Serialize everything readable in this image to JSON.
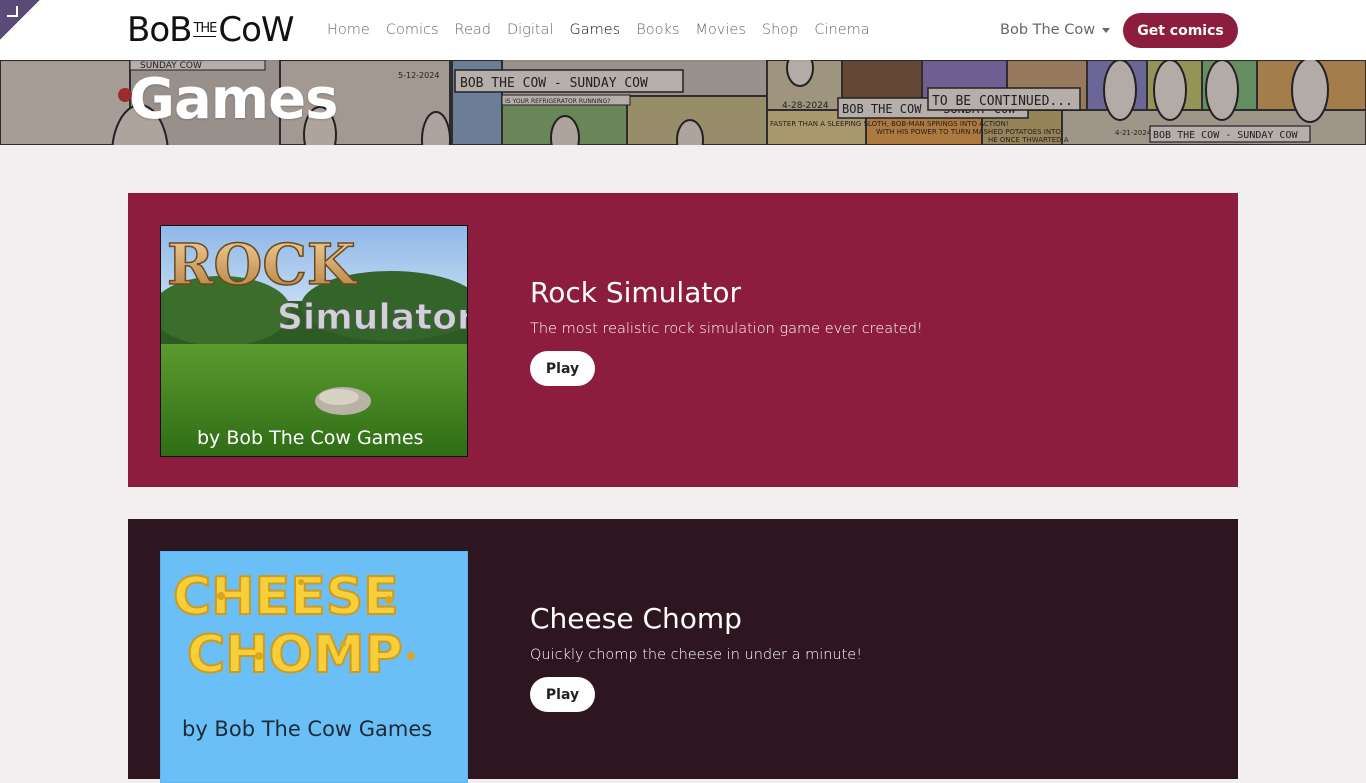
{
  "brand": {
    "logo_text_left": "BoB",
    "logo_text_small": "THE",
    "logo_text_right": "CoW"
  },
  "nav": {
    "items": [
      {
        "label": "Home"
      },
      {
        "label": "Comics"
      },
      {
        "label": "Read"
      },
      {
        "label": "Digital"
      },
      {
        "label": "Games",
        "active": true
      },
      {
        "label": "Books"
      },
      {
        "label": "Movies"
      },
      {
        "label": "Shop"
      },
      {
        "label": "Cinema"
      }
    ],
    "account_label": "Bob The Cow",
    "cta_label": "Get comics"
  },
  "hero": {
    "title": "Games",
    "strip_text": {
      "date_1": "5-12-2024",
      "caption_1": "BOB THE COW - SUNDAY COW",
      "small_1": "IS YOUR REFRIGERATOR RUNNING?",
      "date_2": "4-28-2024",
      "caption_2": "BOB THE COW - SUNDAY COW",
      "continued": "TO BE CONTINUED...",
      "date_3": "4-21-2024",
      "caption_3": "BOB THE COW - SUNDAY COW",
      "faster": "FASTER THAN A SLEEPING SLOTH, BOB-MAN SPRINGS INTO ACTION!",
      "power": "WITH HIS POWER TO TURN MASHED POTATOES INTO",
      "once": "HE ONCE THWARTED A",
      "top_left": "SUNDAY COW"
    }
  },
  "games": [
    {
      "title": "Rock Simulator",
      "description": "The most realistic rock simulation game ever created!",
      "play_label": "Play",
      "thumb_title": "ROCK",
      "thumb_subtitle": "Simulator",
      "thumb_credit": "by Bob The Cow Games"
    },
    {
      "title": "Cheese Chomp",
      "description": "Quickly chomp the cheese in under a minute!",
      "play_label": "Play",
      "thumb_line1": "CHEESE",
      "thumb_line2": "CHOMP",
      "thumb_credit": "by Bob The Cow Games"
    }
  ],
  "colors": {
    "brand_primary": "#8c1d3f",
    "card_dark": "#2e1620",
    "page_bg": "#f3eff1"
  }
}
